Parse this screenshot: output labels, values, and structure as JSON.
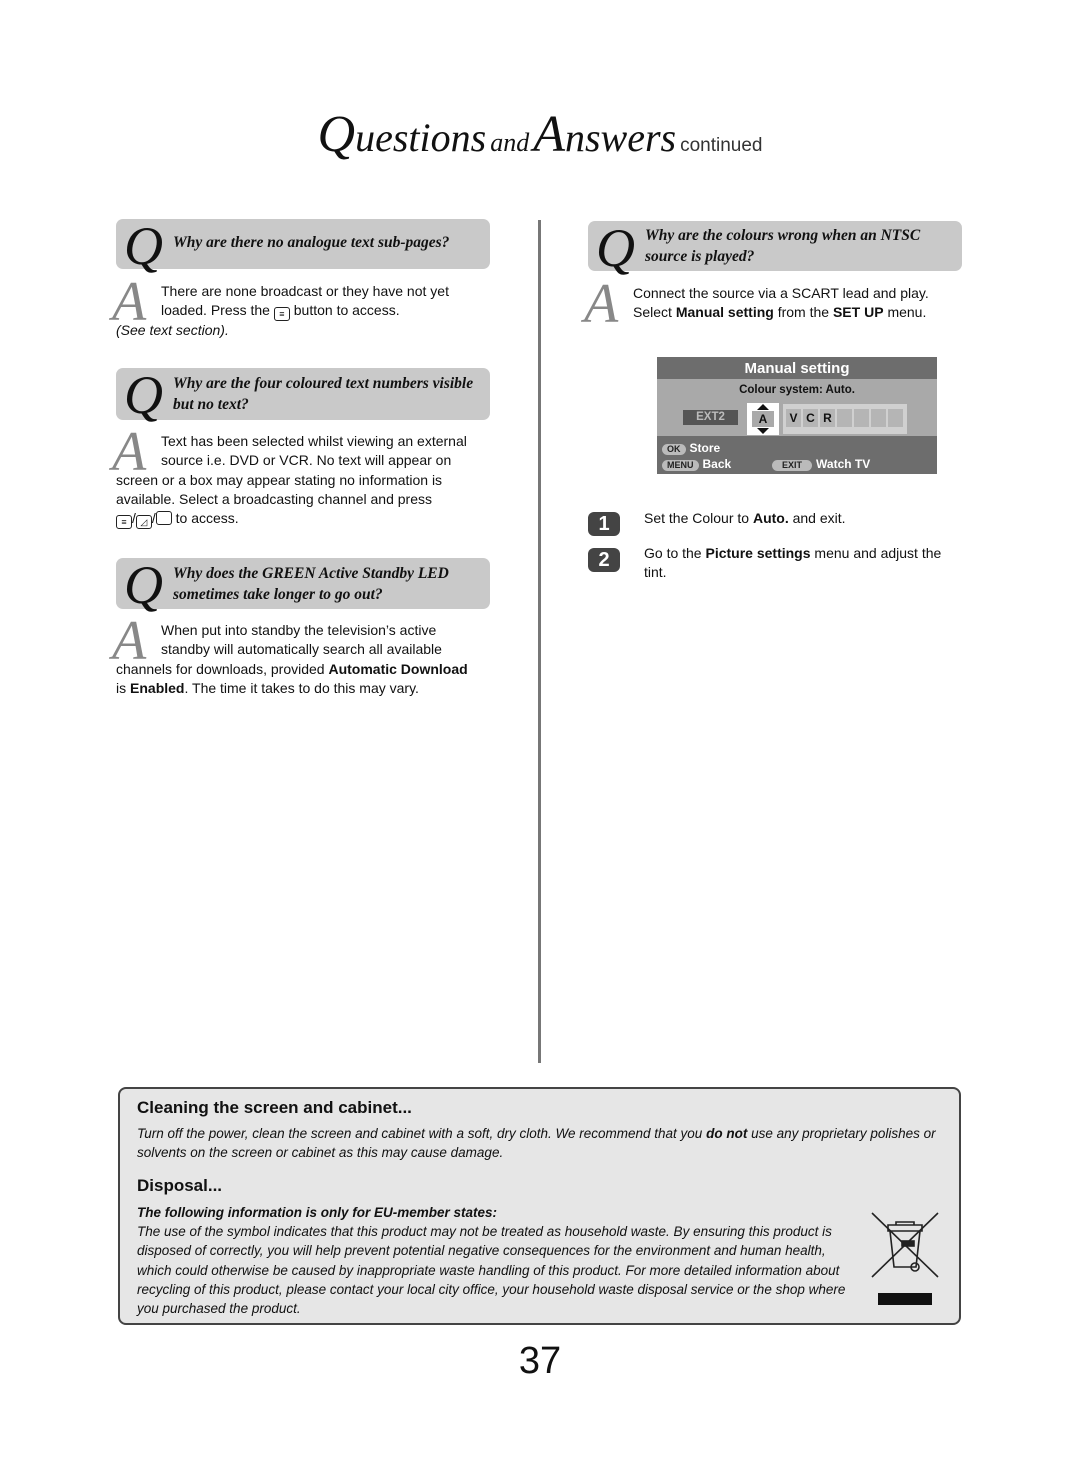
{
  "title": {
    "q": "Q",
    "uestions": "uestions",
    "and": "and",
    "a": "A",
    "nswers": "nswers",
    "continued": "continued"
  },
  "left": [
    {
      "question": "Why are there no analogue text sub-pages?",
      "answer": {
        "line1": "There are none broadcast or they have not yet",
        "line2a": "loaded. Press the",
        "line2b": "button to access.",
        "line3": "(See text section)."
      }
    },
    {
      "question": "Why are the four coloured text numbers visible but no text?",
      "answer": {
        "line1": "Text has been selected whilst viewing an external",
        "line2": "source i.e. DVD or VCR. No text will appear on",
        "line3": "screen or a box may appear stating no information is",
        "line4": "available. Select a broadcasting channel and press",
        "line5": "to access."
      }
    },
    {
      "question": "Why does the GREEN Active Standby LED sometimes take longer to go out?",
      "answer": {
        "line1": "When put into standby the television’s active",
        "line2": "standby will automatically search all available",
        "line3a": "channels for downloads, provided",
        "line3b": "Automatic Download",
        "line4a": "is",
        "line4b": "Enabled",
        "line4c": ". The time it takes to do this may vary."
      }
    }
  ],
  "right": {
    "question": "Why are the colours wrong when an NTSC source is played?",
    "answer": {
      "line1": "Connect the source via a SCART lead and play.",
      "line2a": "Select",
      "line2b": "Manual setting",
      "line2c": "from the",
      "line2d": "SET UP",
      "line2e": "menu."
    },
    "panel": {
      "title": "Manual setting",
      "colour_system": "Colour system: Auto.",
      "source": "EXT2",
      "selected_char": "A",
      "chars": [
        "V",
        "C",
        "R",
        "",
        "",
        "",
        "",
        ""
      ],
      "ok_key": "OK",
      "ok_label": "Store",
      "menu_key": "MENU",
      "menu_label": "Back",
      "exit_key": "EXIT",
      "exit_label": "Watch TV"
    },
    "steps": [
      {
        "num": "1",
        "a": "Set the Colour to",
        "b": "Auto.",
        "c": "and exit."
      },
      {
        "num": "2",
        "a": "Go to the",
        "b": "Picture settings",
        "c": "menu and adjust the tint."
      }
    ]
  },
  "bottom": {
    "cleaning_title": "Cleaning the screen and cabinet...",
    "cleaning_a": "Turn off the power, clean the screen and cabinet with a soft, dry cloth. We recommend that you",
    "cleaning_b": "do not",
    "cleaning_c": "use any proprietary polishes or",
    "cleaning_d": "solvents on the screen or cabinet as this may cause damage.",
    "disposal_title": "Disposal...",
    "disposal_sub": "The following information is only for EU-member states:",
    "disposal_lines": [
      "The use of the symbol indicates that this product may not be treated as household waste. By ensuring this product is",
      "disposed of correctly, you will help prevent potential negative consequences for the environment and human health,",
      "which could otherwise be caused by inappropriate waste handling of this product. For more detailed information about",
      "recycling of this product, please contact your local city office, your household waste disposal service or the shop where",
      "you purchased the product."
    ],
    "icon": "crossed-out-wheelie-bin-icon"
  },
  "page_number": "37"
}
